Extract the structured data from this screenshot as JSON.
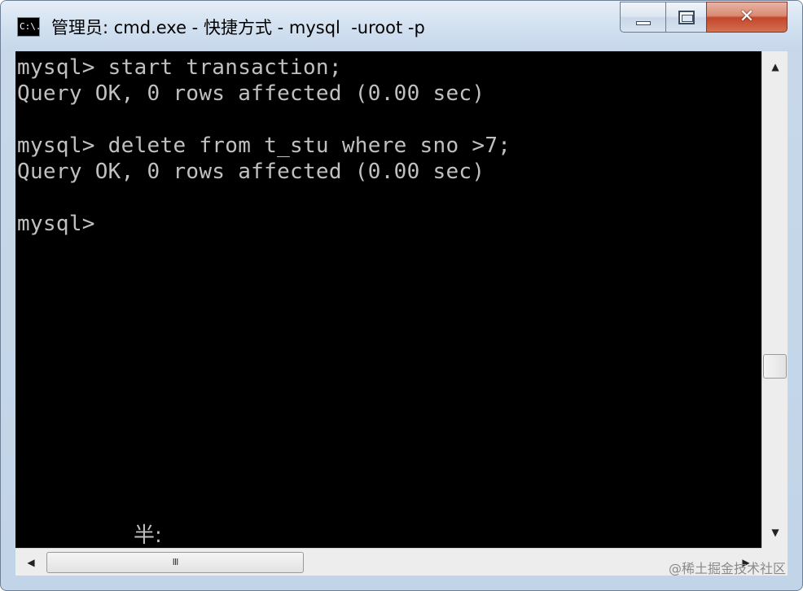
{
  "window": {
    "title": "管理员: cmd.exe - 快捷方式 - mysql  -uroot -p",
    "icon_text": "C:\\."
  },
  "caption": {
    "minimize_icon": "minimize-icon",
    "maximize_icon": "maximize-icon",
    "close_glyph": "✕"
  },
  "console": {
    "lines": [
      "mysql> start transaction;",
      "Query OK, 0 rows affected (0.00 sec)",
      "",
      "mysql> delete from t_stu where sno >7;",
      "Query OK, 0 rows affected (0.00 sec)",
      "",
      "mysql>"
    ],
    "ime_indicator": "半:"
  },
  "scrollbars": {
    "up_arrow": "▲",
    "down_arrow": "▼",
    "left_arrow": "◀",
    "right_arrow": "▶",
    "h_thumb_grip": "III"
  },
  "watermark": "@稀土掘金技术社区",
  "colors": {
    "console_bg": "#000000",
    "console_fg": "#c0c0c0",
    "close_button": "#c4462b"
  }
}
